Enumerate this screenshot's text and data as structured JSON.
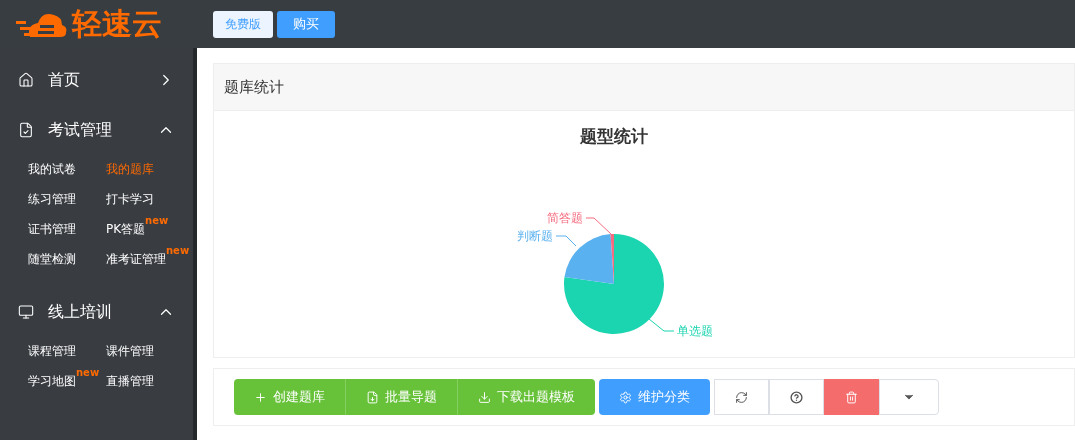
{
  "header": {
    "logo": "轻速云",
    "buttons": [
      {
        "label": "免费版",
        "kind": "plain"
      },
      {
        "label": "购买",
        "kind": "primary"
      }
    ]
  },
  "sidebar": {
    "sections": [
      {
        "label": "首页",
        "expanded": false
      },
      {
        "label": "考试管理",
        "expanded": true,
        "items": [
          {
            "label": "我的试卷",
            "selected": false
          },
          {
            "label": "我的题库",
            "selected": true
          },
          {
            "label": "练习管理",
            "selected": false
          },
          {
            "label": "打卡学习",
            "selected": false
          },
          {
            "label": "证书管理",
            "selected": false
          },
          {
            "label": "PK答题",
            "selected": false,
            "badge": "new"
          },
          {
            "label": "随堂检测",
            "selected": false
          },
          {
            "label": "准考证管理",
            "selected": false,
            "badge": "new"
          }
        ]
      },
      {
        "label": "线上培训",
        "expanded": true,
        "items": [
          {
            "label": "课程管理",
            "selected": false
          },
          {
            "label": "课件管理",
            "selected": false
          },
          {
            "label": "学习地图",
            "selected": false,
            "badge": "new"
          },
          {
            "label": "直播管理",
            "selected": false
          }
        ]
      }
    ]
  },
  "panel": {
    "title": "题库统计",
    "chart_title": "题型统计",
    "slices": [
      {
        "label": "单选题",
        "color": "#1bd4b0"
      },
      {
        "label": "判断题",
        "color": "#5ab1ef"
      },
      {
        "label": "简答题",
        "color": "#f56b7f"
      }
    ]
  },
  "toolbar": {
    "buttons": [
      {
        "label": "创建题库",
        "kind": "success"
      },
      {
        "label": "批量导题",
        "kind": "success"
      },
      {
        "label": "下载出题模板",
        "kind": "success"
      },
      {
        "label": "维护分类",
        "kind": "primary"
      },
      {
        "kind": "default"
      },
      {
        "kind": "default"
      },
      {
        "kind": "danger"
      },
      {
        "kind": "default"
      }
    ]
  }
}
